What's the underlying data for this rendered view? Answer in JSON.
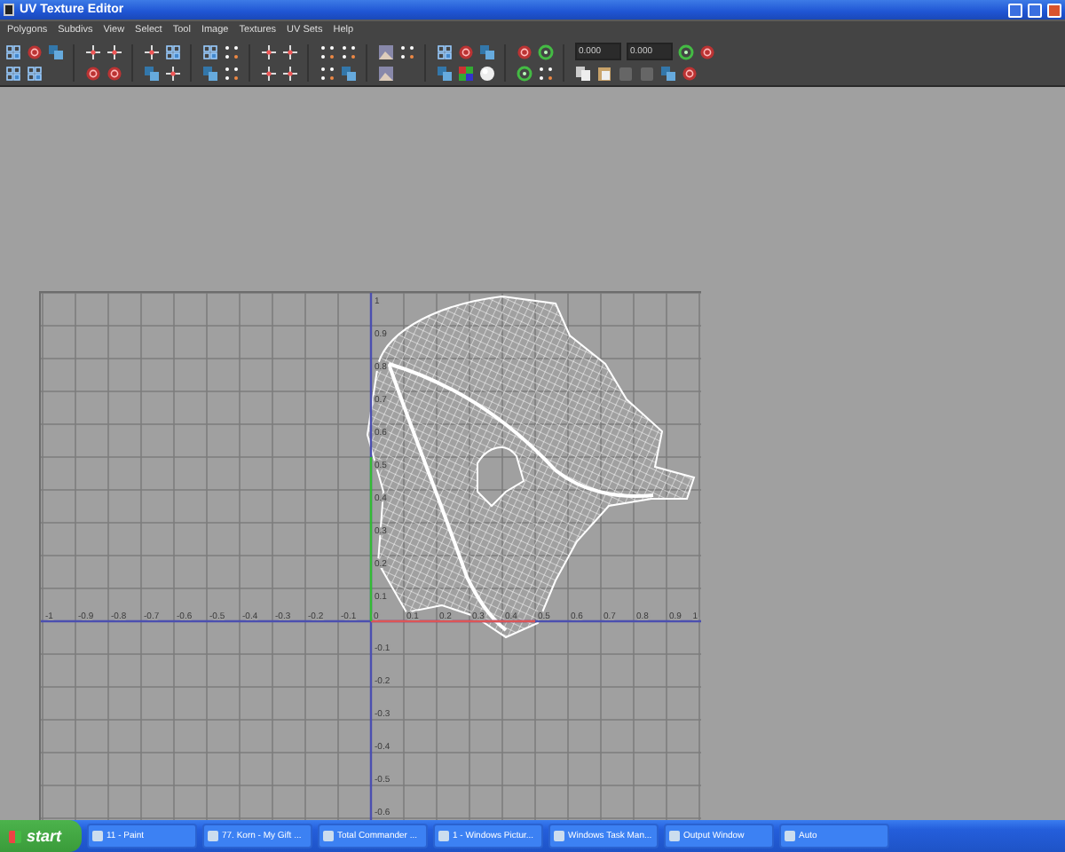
{
  "window": {
    "title": "UV Texture Editor"
  },
  "menu": [
    "Polygons",
    "Subdivs",
    "View",
    "Select",
    "Tool",
    "Image",
    "Textures",
    "UV Sets",
    "Help"
  ],
  "toolbar": {
    "fields": [
      {
        "value": "0.000"
      },
      {
        "value": "0.000"
      }
    ]
  },
  "grid": {
    "x_labels": [
      "-1",
      "-0.9",
      "-0.8",
      "-0.7",
      "-0.6",
      "-0.5",
      "-0.4",
      "-0.3",
      "-0.2",
      "-0.1",
      "0",
      "0.1",
      "0.2",
      "0.3",
      "0.4",
      "0.5",
      "0.6",
      "0.7",
      "0.8",
      "0.9",
      "1"
    ],
    "y_labels": [
      "1",
      "0.9",
      "0.8",
      "0.7",
      "0.6",
      "0.5",
      "0.4",
      "0.3",
      "0.2",
      "0.1",
      "-0.1",
      "-0.2",
      "-0.3",
      "-0.4",
      "-0.5",
      "-0.6"
    ]
  },
  "taskbar": {
    "start": "start",
    "tasks": [
      {
        "label": "11 - Paint"
      },
      {
        "label": "77. Korn - My Gift ..."
      },
      {
        "label": "Total Commander ..."
      },
      {
        "label": "1 - Windows Pictur..."
      },
      {
        "label": "Windows Task Man..."
      },
      {
        "label": "Output Window"
      },
      {
        "label": "Auto"
      }
    ]
  }
}
